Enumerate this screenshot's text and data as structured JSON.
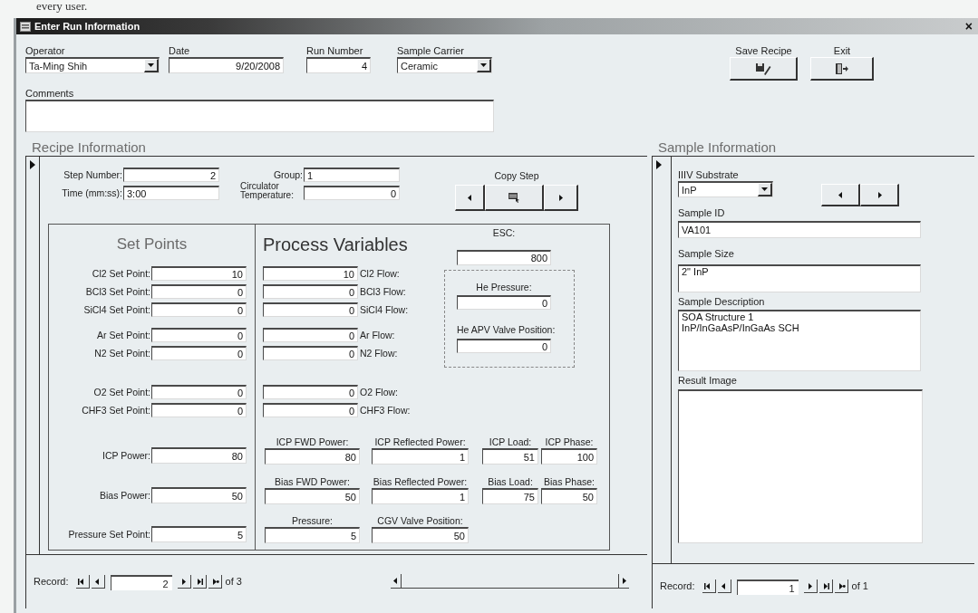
{
  "caption": "every user.",
  "window": {
    "title": "Enter Run Information",
    "close": "×"
  },
  "header": {
    "fields": [
      {
        "kind": "combo",
        "label": "Operator",
        "value": "Ta-Ming Shih"
      },
      {
        "kind": "text",
        "label": "Date",
        "value": "9/20/2008"
      },
      {
        "kind": "text",
        "label": "Run Number",
        "value": "4"
      },
      {
        "kind": "combo",
        "label": "Sample Carrier",
        "value": "Ceramic"
      }
    ],
    "buttons": [
      {
        "label": "Save Recipe",
        "kind": "save"
      },
      {
        "label": "Exit",
        "kind": "exit"
      }
    ],
    "comments": {
      "label": "Comments"
    }
  },
  "recipe": {
    "title": "Recipe Information",
    "step_number": {
      "label": "Step Number:",
      "value": "2"
    },
    "group": {
      "label": "Group:",
      "value": "1"
    },
    "time": {
      "label": "Time (mm:ss):",
      "value": "3:00"
    },
    "circulator_temperature": {
      "label": "Circulator Temperature:",
      "value": "0"
    },
    "copy_step": {
      "label": "Copy Step"
    },
    "set_points_title": "Set Points",
    "process_variables_title": "Process Variables",
    "gas_groups": [
      [
        {
          "set_label": "Cl2 Set Point:",
          "set_value": "10",
          "flow_value": "10",
          "flow_label": "Cl2 Flow:"
        },
        {
          "set_label": "BCl3 Set Point:",
          "set_value": "0",
          "flow_value": "0",
          "flow_label": "BCl3 Flow:"
        },
        {
          "set_label": "SiCl4 Set Point:",
          "set_value": "0",
          "flow_value": "0",
          "flow_label": "SiCl4 Flow:"
        }
      ],
      [
        {
          "set_label": "Ar Set Point:",
          "set_value": "0",
          "flow_value": "0",
          "flow_label": "Ar Flow:"
        },
        {
          "set_label": "N2 Set Point:",
          "set_value": "0",
          "flow_value": "0",
          "flow_label": "N2 Flow:"
        }
      ],
      [
        {
          "set_label": "O2 Set Point:",
          "set_value": "0",
          "flow_value": "0",
          "flow_label": "O2 Flow:"
        },
        {
          "set_label": "CHF3 Set Point:",
          "set_value": "0",
          "flow_value": "0",
          "flow_label": "CHF3 Flow:"
        }
      ]
    ],
    "esc": {
      "label": "ESC:",
      "value": "800"
    },
    "he_pressure": {
      "label": "He Pressure:",
      "value": "0"
    },
    "he_apv": {
      "label": "He APV Valve Position:",
      "value": "0"
    },
    "power_rows": [
      {
        "set_label": "ICP Power:",
        "set_value": "80",
        "readings": [
          {
            "label": "ICP FWD Power:",
            "value": "80"
          },
          {
            "label": "ICP Reflected Power:",
            "value": "1"
          },
          {
            "label": "ICP Load:",
            "value": "51"
          },
          {
            "label": "ICP Phase:",
            "value": "100"
          }
        ]
      },
      {
        "set_label": "Bias Power:",
        "set_value": "50",
        "readings": [
          {
            "label": "Bias FWD Power:",
            "value": "50"
          },
          {
            "label": "Bias Reflected Power:",
            "value": "1"
          },
          {
            "label": "Bias Load:",
            "value": "75"
          },
          {
            "label": "Bias Phase:",
            "value": "50"
          }
        ]
      },
      {
        "set_label": "Pressure Set Point:",
        "set_value": "5",
        "readings": [
          {
            "label": "Pressure:",
            "value": "5"
          },
          {
            "label": "CGV Valve Position:",
            "value": "50"
          }
        ]
      }
    ],
    "navigation": {
      "label": "Record:",
      "current": "2",
      "total": "of 3"
    }
  },
  "sample": {
    "title": "Sample Information",
    "substrate": {
      "label": "IIIV Substrate",
      "value": "InP"
    },
    "sample_id": {
      "label": "Sample ID",
      "value": "VA101"
    },
    "sample_size": {
      "label": "Sample Size",
      "value": "2\" InP"
    },
    "description": {
      "label": "Sample Description",
      "value": "SOA Structure 1\nInP/InGaAsP/InGaAs SCH"
    },
    "result_image": {
      "label": "Result Image"
    },
    "navigation": {
      "label": "Record:",
      "current": "1",
      "total": "of 1"
    }
  }
}
